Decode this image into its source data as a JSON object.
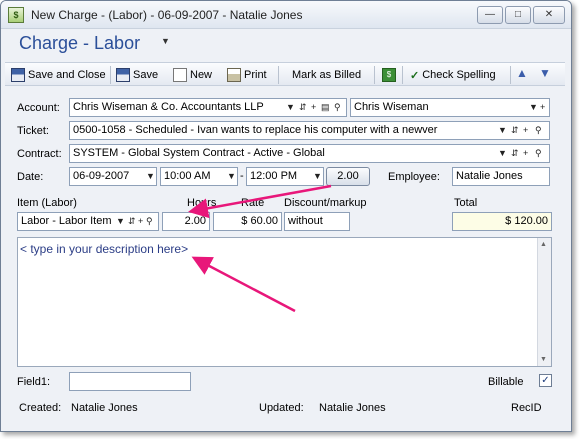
{
  "window": {
    "title": "New Charge - (Labor) - 06-09-2007 - Natalie Jones",
    "app_icon_text": "$"
  },
  "header": {
    "title": "Charge - Labor"
  },
  "toolbar": {
    "save_close": "Save and Close",
    "save": "Save",
    "new": "New",
    "print": "Print",
    "mark_billed": "Mark as Billed",
    "check_spelling": "Check Spelling",
    "spell_abc": "ABC"
  },
  "form": {
    "account_label": "Account:",
    "account_value": "Chris Wiseman & Co. Accountants LLP",
    "contact_value": "Chris Wiseman",
    "ticket_label": "Ticket:",
    "ticket_value": "0500-1058 - Scheduled - Ivan wants to replace his computer with a newver",
    "contract_label": "Contract:",
    "contract_value": "SYSTEM - Global System Contract - Active -  Global",
    "date_label": "Date:",
    "date_value": "06-09-2007",
    "start_time": "10:00 AM",
    "end_time": "12:00 PM",
    "duration": "2.00",
    "employee_label": "Employee:",
    "employee_value": "Natalie Jones"
  },
  "line": {
    "item_header": "Item  (Labor)",
    "hours_header": "Hours",
    "rate_header": "Rate",
    "discount_header": "Discount/markup",
    "total_header": "Total",
    "item_value": "Labor - Labor Item",
    "hours_value": "2.00",
    "rate_value": "$ 60.00",
    "discount_value": "without",
    "total_value": "$ 120.00"
  },
  "description": {
    "placeholder": "< type in your description here>"
  },
  "footer": {
    "field1_label": "Field1:",
    "field1_value": "",
    "billable_label": "Billable",
    "billable_checked": "✓",
    "created_label": "Created:",
    "created_value": "Natalie Jones",
    "updated_label": "Updated:",
    "updated_value": "Natalie Jones",
    "recid_label": "RecID"
  },
  "colors": {
    "title_blue": "#2b4f99",
    "annotation_arrow": "#e8177a"
  }
}
